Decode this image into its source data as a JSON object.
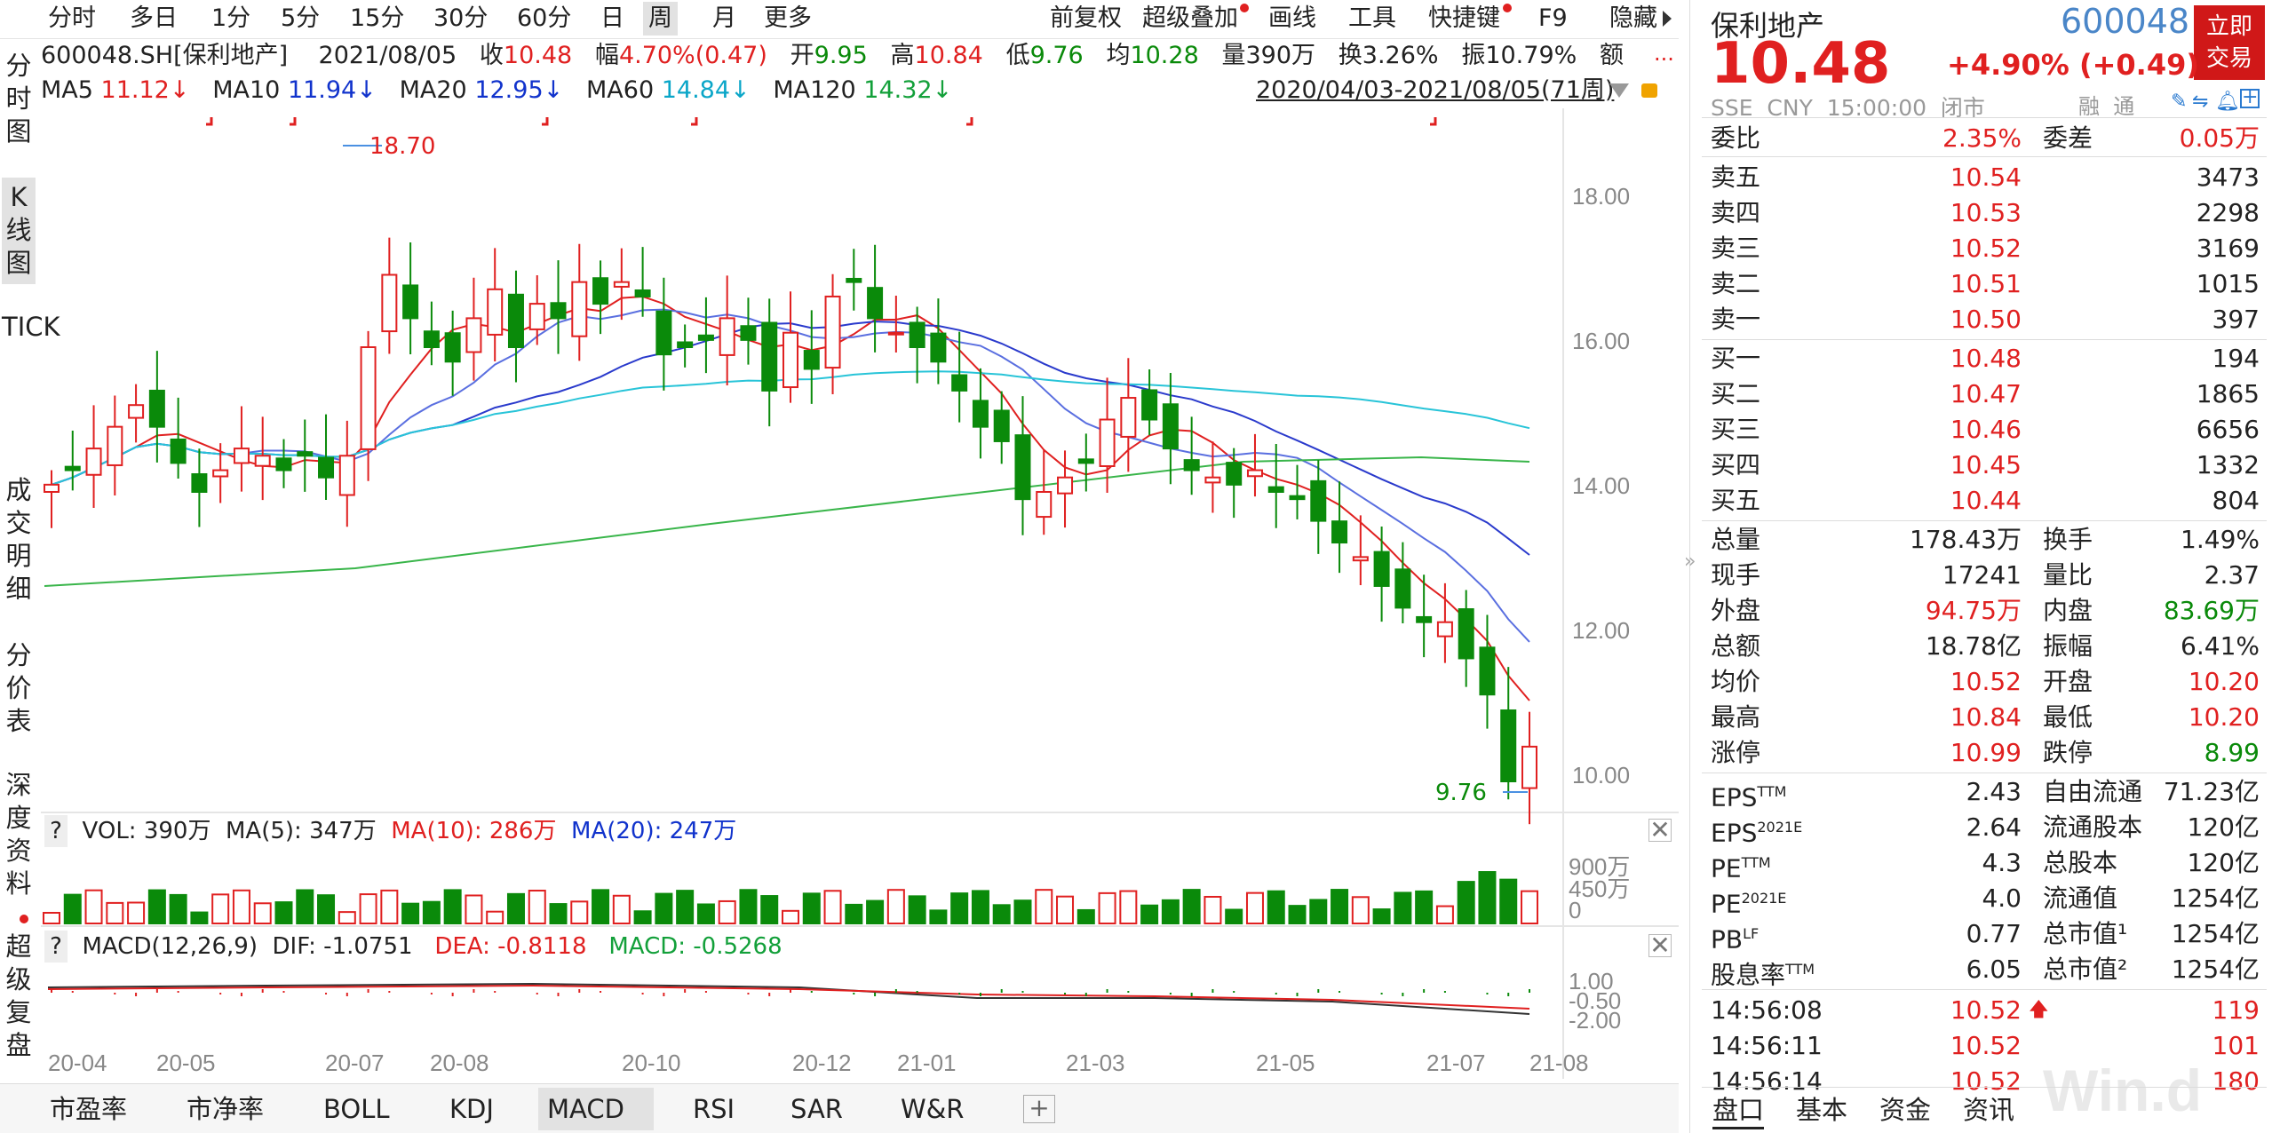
{
  "toolbar": {
    "tabs": [
      "分时",
      "多日",
      "1分",
      "5分",
      "15分",
      "30分",
      "60分",
      "日",
      "周",
      "月",
      "更多"
    ],
    "active": "周",
    "right": [
      "前复权",
      "超级叠加",
      "画线",
      "工具",
      "快捷键",
      "F9",
      "隐藏"
    ]
  },
  "side_tabs": [
    "分时图",
    "K线图",
    "TICK",
    "成交明细",
    "分价表",
    "深度资料",
    "超级复盘"
  ],
  "info": {
    "code": "600048.SH[保利地产]",
    "date": "2021/08/05",
    "close_label": "收",
    "close": "10.48",
    "chg_label": "幅",
    "chg": "4.70%(0.47)",
    "open_label": "开",
    "open": "9.95",
    "high_label": "高",
    "high": "10.84",
    "low_label": "低",
    "low": "9.76",
    "avg_label": "均",
    "avg": "10.28",
    "vol_label": "量",
    "vol": "390万",
    "turn_label": "换",
    "turn": "3.26%",
    "amp_label": "振",
    "amp": "10.79%",
    "amt_label": "额",
    "more": "..."
  },
  "ma": {
    "ma5_label": "MA5",
    "ma5": "11.12↓",
    "ma10_label": "MA10",
    "ma10": "11.94↓",
    "ma20_label": "MA20",
    "ma20": "12.95↓",
    "ma60_label": "MA60",
    "ma60": "14.84↓",
    "ma120_label": "MA120",
    "ma120": "14.32↓",
    "range": "2020/04/03-2021/08/05(71周)"
  },
  "price_axis": [
    "18.00",
    "16.00",
    "14.00",
    "12.00",
    "10.00"
  ],
  "annotations": {
    "high": "18.70",
    "low": "9.76"
  },
  "vol_panel": {
    "q": "?",
    "vol": "VOL: 390万",
    "ma5": "MA(5): 347万",
    "ma10": "MA(10): 286万",
    "ma20": "MA(20): 247万",
    "axis": [
      "900万",
      "450万",
      "0"
    ]
  },
  "macd_panel": {
    "q": "?",
    "title": "MACD(12,26,9)",
    "dif": "DIF: -1.0751",
    "dea": "DEA: -0.8118",
    "macd": "MACD: -0.5268",
    "axis": [
      "1.00",
      "-0.50",
      "-2.00"
    ]
  },
  "x_labels": [
    "20-04",
    "20-05",
    "20-07",
    "20-08",
    "20-10",
    "20-12",
    "21-01",
    "21-03",
    "21-05",
    "21-07",
    "21-08"
  ],
  "bottom_tabs": [
    "市盈率",
    "市净率",
    "BOLL",
    "KDJ",
    "MACD",
    "RSI",
    "SAR",
    "W&R"
  ],
  "bottom_active": "MACD",
  "quote": {
    "name": "保利地产",
    "code": "600048",
    "price": "10.48",
    "change": "+4.90% (+0.49)",
    "trade_btn": "立即交易",
    "meta": "SSE  CNY  15:00:00  闭市",
    "tags": "融  通",
    "weibi_label": "委比",
    "weibi": "2.35%",
    "weicha_label": "委差",
    "weicha": "0.05万",
    "asks": [
      {
        "label": "卖五",
        "price": "10.54",
        "vol": "3473"
      },
      {
        "label": "卖四",
        "price": "10.53",
        "vol": "2298"
      },
      {
        "label": "卖三",
        "price": "10.52",
        "vol": "3169"
      },
      {
        "label": "卖二",
        "price": "10.51",
        "vol": "1015"
      },
      {
        "label": "卖一",
        "price": "10.50",
        "vol": "397"
      }
    ],
    "bids": [
      {
        "label": "买一",
        "price": "10.48",
        "vol": "194"
      },
      {
        "label": "买二",
        "price": "10.47",
        "vol": "1865"
      },
      {
        "label": "买三",
        "price": "10.46",
        "vol": "6656"
      },
      {
        "label": "买四",
        "price": "10.45",
        "vol": "1332"
      },
      {
        "label": "买五",
        "price": "10.44",
        "vol": "804"
      }
    ],
    "stats": [
      {
        "l1": "总量",
        "v1": "178.43万",
        "c1": "",
        "l2": "换手",
        "v2": "1.49%",
        "c2": ""
      },
      {
        "l1": "现手",
        "v1": "17241",
        "c1": "",
        "l2": "量比",
        "v2": "2.37",
        "c2": ""
      },
      {
        "l1": "外盘",
        "v1": "94.75万",
        "c1": "red",
        "l2": "内盘",
        "v2": "83.69万",
        "c2": "green"
      },
      {
        "l1": "总额",
        "v1": "18.78亿",
        "c1": "",
        "l2": "振幅",
        "v2": "6.41%",
        "c2": ""
      },
      {
        "l1": "均价",
        "v1": "10.52",
        "c1": "red",
        "l2": "开盘",
        "v2": "10.20",
        "c2": "red"
      },
      {
        "l1": "最高",
        "v1": "10.84",
        "c1": "red",
        "l2": "最低",
        "v2": "10.20",
        "c2": "red"
      },
      {
        "l1": "涨停",
        "v1": "10.99",
        "c1": "red",
        "l2": "跌停",
        "v2": "8.99",
        "c2": "green"
      }
    ],
    "fin": [
      {
        "l1": "EPS",
        "s1": "TTM",
        "v1": "2.43",
        "l2": "自由流通",
        "v2": "71.23亿"
      },
      {
        "l1": "EPS",
        "s1": "2021E",
        "v1": "2.64",
        "l2": "流通股本",
        "v2": "120亿"
      },
      {
        "l1": "PE",
        "s1": "TTM",
        "v1": "4.3",
        "l2": "总股本",
        "v2": "120亿"
      },
      {
        "l1": "PE",
        "s1": "2021E",
        "v1": "4.0",
        "l2": "流通值",
        "v2": "1254亿"
      },
      {
        "l1": "PB",
        "s1": "LF",
        "v1": "0.77",
        "l2": "总市值¹",
        "v2": "1254亿"
      },
      {
        "l1": "股息率",
        "s1": "TTM",
        "v1": "6.05",
        "l2": "总市值²",
        "v2": "1254亿"
      }
    ],
    "ticks": [
      {
        "time": "14:56:08",
        "price": "10.52",
        "arrow": "🡅",
        "vol": "119"
      },
      {
        "time": "14:56:11",
        "price": "10.52",
        "arrow": "",
        "vol": "101"
      },
      {
        "time": "14:56:14",
        "price": "10.52",
        "arrow": "",
        "vol": "180"
      }
    ],
    "tabs": [
      "盘口",
      "基本",
      "资金",
      "资讯"
    ],
    "active_tab": "盘口",
    "watermark": "Win.d"
  }
}
